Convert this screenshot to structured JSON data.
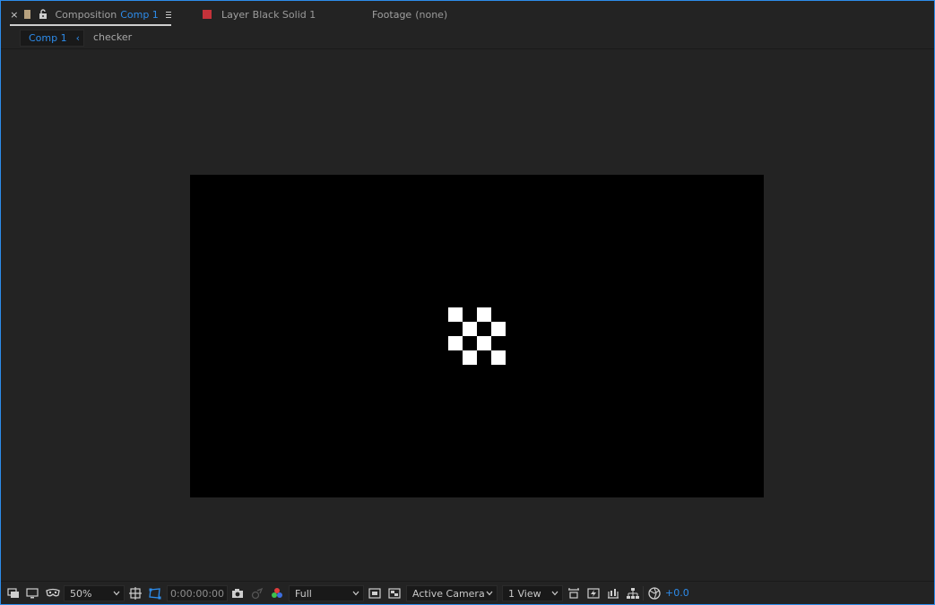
{
  "tabs": {
    "composition": {
      "close_symbol": "×",
      "label": "Composition",
      "value": "Comp 1",
      "swatch_color": "#b7a27f"
    },
    "layer": {
      "label": "Layer",
      "value": "Black Solid 1",
      "swatch_color": "#c4323a"
    },
    "footage": {
      "label": "Footage",
      "value": "(none)"
    }
  },
  "breadcrumb": {
    "items": [
      {
        "label": "Comp 1",
        "active": true
      },
      {
        "label": "checker",
        "active": false
      }
    ]
  },
  "viewer": {
    "frame_color": "#000000",
    "checker_colors": [
      "#ffffff",
      "#000000"
    ]
  },
  "toolbar": {
    "magnification": "50%",
    "timecode": "0:00:00:00",
    "resolution": "Full",
    "camera": "Active Camera",
    "view_layout": "1 View",
    "exposure": "+0.0"
  },
  "colors": {
    "accent": "#2d8ceb",
    "panel_bg": "#232323",
    "field_bg": "#191919"
  }
}
